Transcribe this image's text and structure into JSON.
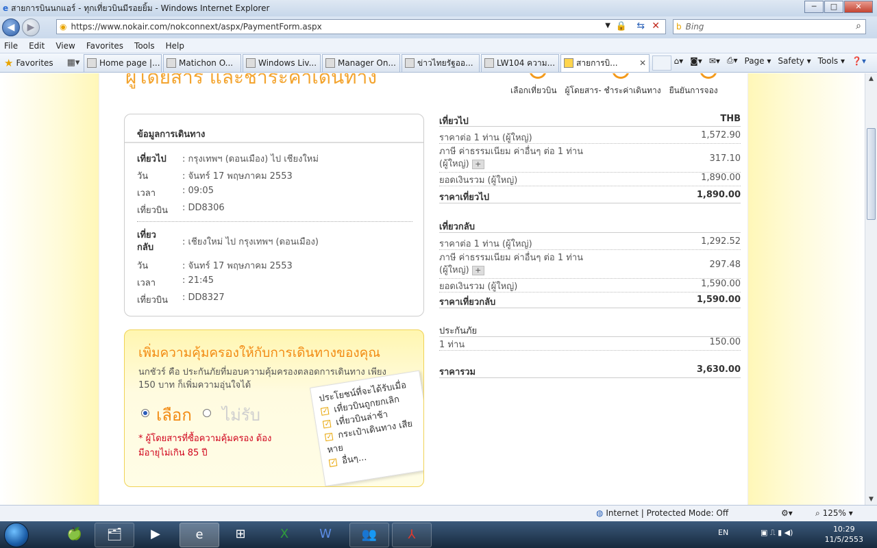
{
  "window": {
    "title": "สายการบินนกแอร์ - ทุกเที่ยวบินมีรอยยิ้ม - Windows Internet Explorer",
    "min": "─",
    "max": "□",
    "close": "✕"
  },
  "address": {
    "url": "https://www.nokair.com/nokconnext/aspx/PaymentForm.aspx",
    "search_placeholder": "Bing"
  },
  "menu": [
    "File",
    "Edit",
    "View",
    "Favorites",
    "Tools",
    "Help"
  ],
  "favorites_label": "Favorites",
  "tabs": [
    "Home page |...",
    "Matichon O...",
    "Windows Liv...",
    "Manager On...",
    "ข่าวไทยรัฐออ...",
    "LW104 ความ...",
    "สายการบิ..."
  ],
  "command": {
    "page": "Page ▾",
    "safety": "Safety ▾",
    "tools": "Tools ▾"
  },
  "page": {
    "header": "ผู้โดยสาร และชำระค่าเดินทาง",
    "steps": [
      "เลือกเที่ยวบิน",
      "ผู้โดยสาร- ชำระค่าเดินทาง",
      "ยืนยันการจอง"
    ],
    "trip": {
      "title": "ข้อมูลการเดินทาง",
      "out_label": "เที่ยวไป",
      "out_route": ": กรุงเทพฯ (ดอนเมือง) ไป เชียงใหม่",
      "out_date_k": "วัน",
      "out_date": ": จันทร์ 17 พฤษภาคม 2553",
      "out_time_k": "เวลา",
      "out_time": ": 09:05",
      "out_flight_k": "เที่ยวบิน",
      "out_flight": ": DD8306",
      "ret_label_1": "เที่ยว",
      "ret_label_2": "กลับ",
      "ret_route": ": เชียงใหม่ ไป กรุงเทพฯ (ดอนเมือง)",
      "ret_date_k": "วัน",
      "ret_date": ": จันทร์ 17 พฤษภาคม 2553",
      "ret_time_k": "เวลา",
      "ret_time": ": 21:45",
      "ret_flight_k": "เที่ยวบิน",
      "ret_flight": ": DD8327"
    },
    "insurance": {
      "title": "เพิ่มความคุ้มครองให้กับการเดินทางของคุณ",
      "desc": "นกชัวร์ คือ ประกันภัยที่มอบความคุ้มครองตลอดการเดินทาง เพียง 150 บาท ก็เพิ่มความอุ่นใจได้",
      "opt_yes": "เลือก",
      "opt_no": "ไม่รับ",
      "warning": "* ผู้โดยสารที่ซื้อความคุ้มครอง ต้องมีอายุไม่เกิน 85 ปี",
      "card_title": "ประโยชน์ที่จะได้รับเมื่อ",
      "benefits": [
        "เที่ยวบินถูกยกเลิก",
        "เที่ยวบินล่าช้า",
        "กระเป๋าเดินทาง เสียหาย",
        "อื่นๆ..."
      ]
    },
    "price": {
      "out_title": "เที่ยวไป",
      "currency": "THB",
      "out_fare_k": "ราคาต่อ 1 ท่าน (ผู้ใหญ่)",
      "out_fare": "1,572.90",
      "out_tax_k": "ภาษี ค่าธรรมเนียม ค่าอื่นๆ ต่อ 1 ท่าน",
      "out_tax_k2": "(ผู้ใหญ่)",
      "out_tax": "317.10",
      "out_sum_k": "ยอดเงินรวม (ผู้ใหญ่)",
      "out_sum": "1,890.00",
      "out_total_k": "ราคาเที่ยวไป",
      "out_total": "1,890.00",
      "ret_title": "เที่ยวกลับ",
      "ret_fare_k": "ราคาต่อ 1 ท่าน (ผู้ใหญ่)",
      "ret_fare": "1,292.52",
      "ret_tax_k": "ภาษี ค่าธรรมเนียม ค่าอื่นๆ ต่อ 1 ท่าน",
      "ret_tax_k2": "(ผู้ใหญ่)",
      "ret_tax": "297.48",
      "ret_sum_k": "ยอดเงินรวม (ผู้ใหญ่)",
      "ret_sum": "1,590.00",
      "ret_total_k": "ราคาเที่ยวกลับ",
      "ret_total": "1,590.00",
      "ins_title": "ประกันภัย",
      "ins_k": "1 ท่าน",
      "ins_v": "150.00",
      "grand_k": "ราคารวม",
      "grand": "3,630.00"
    }
  },
  "status": {
    "zone": "Internet | Protected Mode: Off",
    "zoom": "125%"
  },
  "tray": {
    "lang": "EN",
    "time": "10:29",
    "date": "11/5/2553"
  }
}
